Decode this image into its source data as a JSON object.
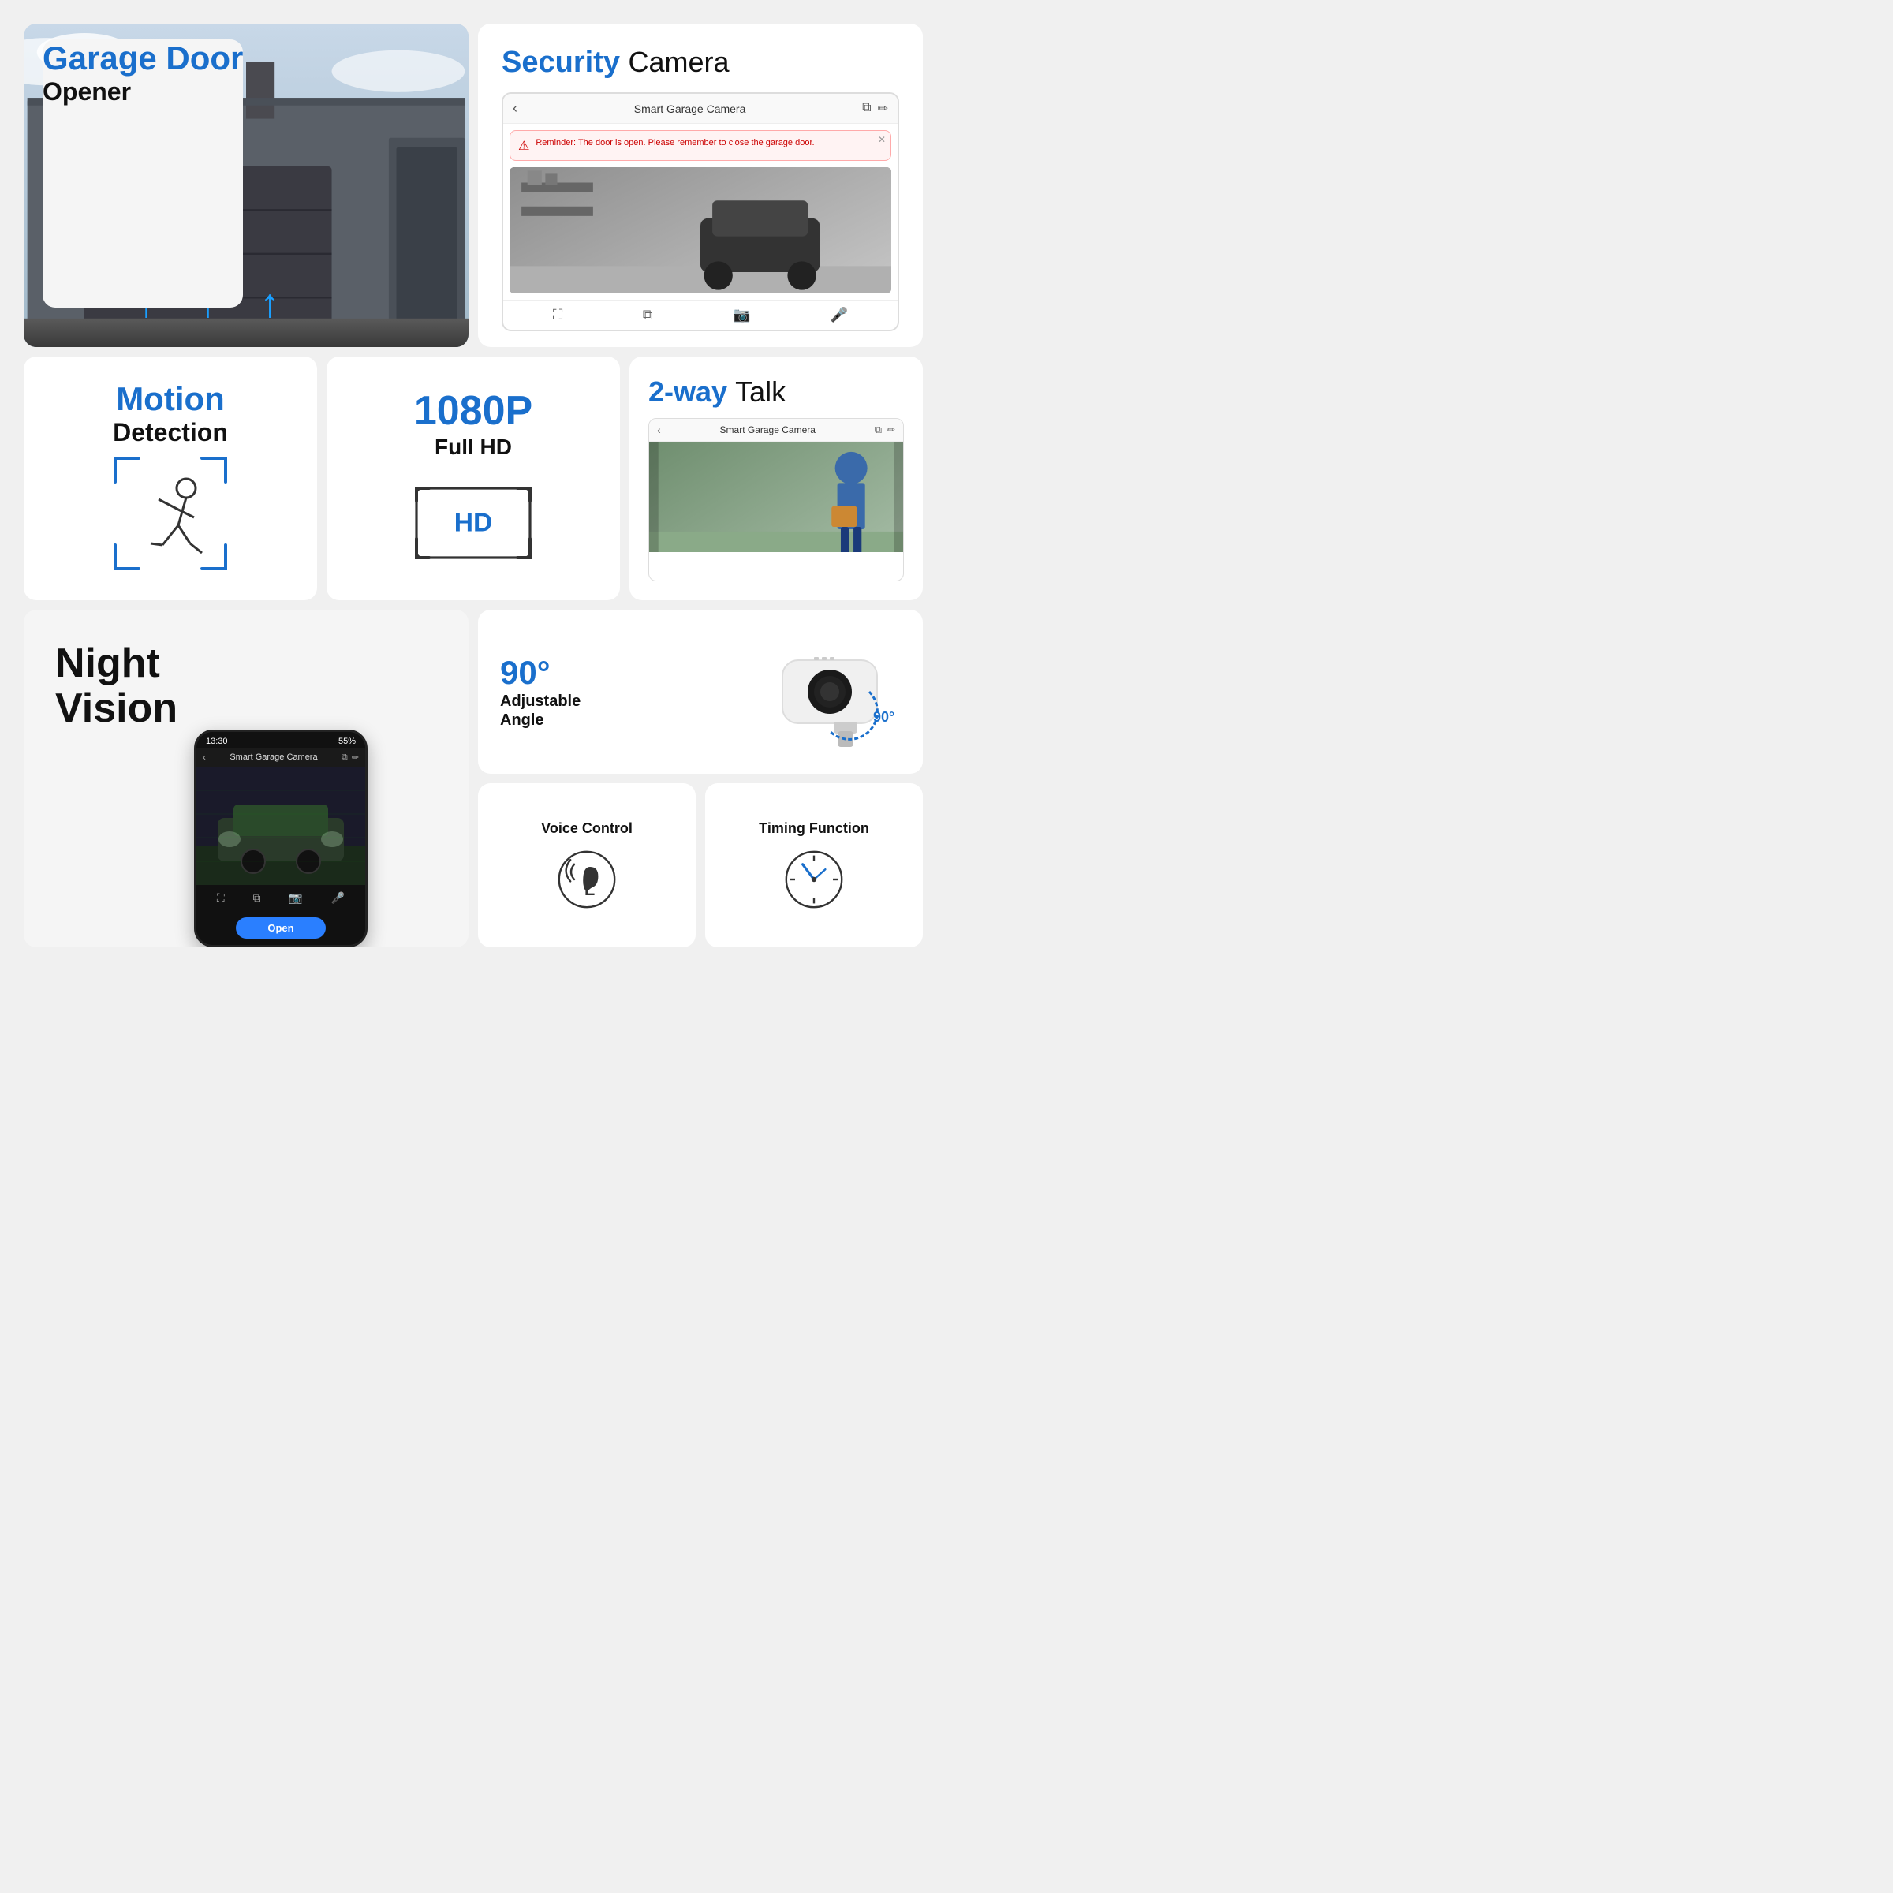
{
  "colors": {
    "blue": "#1a6fcc",
    "black": "#111111",
    "bg": "#f0f0f0",
    "white": "#ffffff"
  },
  "row1": {
    "garage": {
      "title_blue": "Garage Door",
      "title_black": "Opener"
    },
    "security": {
      "title_blue": "Security",
      "title_black": "Camera",
      "phone": {
        "back": "‹",
        "title": "Smart Garage Camera",
        "alert": "Reminder: The door is open. Please remember to close the garage door.",
        "bottom_icons": [
          "⛶",
          "⧉",
          "📷",
          "🎤"
        ]
      }
    }
  },
  "row2": {
    "motion": {
      "title_blue": "Motion",
      "title_black": "Detection"
    },
    "hd": {
      "title": "1080P",
      "subtitle": "Full HD"
    },
    "twoway": {
      "title_blue": "2-way",
      "title_black": "Talk",
      "phone": {
        "back": "‹",
        "title": "Smart Garage Camera"
      }
    }
  },
  "row3": {
    "night": {
      "title_line1": "Night",
      "title_line2": "Vision",
      "phone": {
        "status_left": "13:30",
        "status_right": "55%",
        "back": "‹",
        "title": "Smart Garage Camera"
      }
    },
    "angle": {
      "value": "90°",
      "label_line1": "Adjustable",
      "label_line2": "Angle",
      "angle_label": "90°"
    },
    "voice": {
      "label": "Voice Control"
    },
    "timing": {
      "label": "Timing Function"
    }
  }
}
